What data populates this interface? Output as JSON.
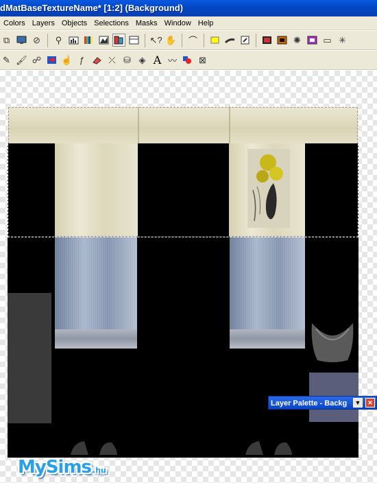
{
  "window": {
    "title": "dMatBaseTextureName* [1:2] (Background)"
  },
  "menubar": {
    "items": [
      {
        "label": "Colors"
      },
      {
        "label": "Layers"
      },
      {
        "label": "Objects"
      },
      {
        "label": "Selections"
      },
      {
        "label": "Masks"
      },
      {
        "label": "Window"
      },
      {
        "label": "Help"
      }
    ]
  },
  "toolbar1": {
    "icons": [
      "copy-icon",
      "browse-icon",
      "no-icon",
      "zoom-icon",
      "histogram-icon",
      "color-bars-icon",
      "levels-icon",
      "layer-palette-icon",
      "tool-palette-icon",
      "help-cursor-icon",
      "grab-icon",
      "arch-icon",
      "yellow-swatch-icon",
      "brush-stroke-icon",
      "arrow-box-icon",
      "screen-icon",
      "frame-icon",
      "kaleidoscope-icon",
      "frame-purple-icon",
      "window-icon",
      "star-icon"
    ]
  },
  "toolbar2": {
    "icons": [
      "pencil-icon",
      "paintbrush-icon",
      "clone-icon",
      "swap-icon",
      "retouch-icon",
      "brush-icon",
      "eraser-icon",
      "dropper-icon",
      "flood-fill-icon",
      "fill-icon",
      "text-icon",
      "draw-icon",
      "shapes-icon",
      "tube-icon"
    ],
    "text_tool_label": "A"
  },
  "layer_palette": {
    "title": "Layer Palette - Backg",
    "pin_glyph": "▼",
    "close_glyph": "✕"
  },
  "logo": {
    "text": "MySims",
    "suffix": ".hu"
  },
  "colors": {
    "titlebar": "#0348c6",
    "menubar": "#ece9d8",
    "texture_background": "#000000",
    "layer_palette_swatch": "#5a5e7a"
  }
}
